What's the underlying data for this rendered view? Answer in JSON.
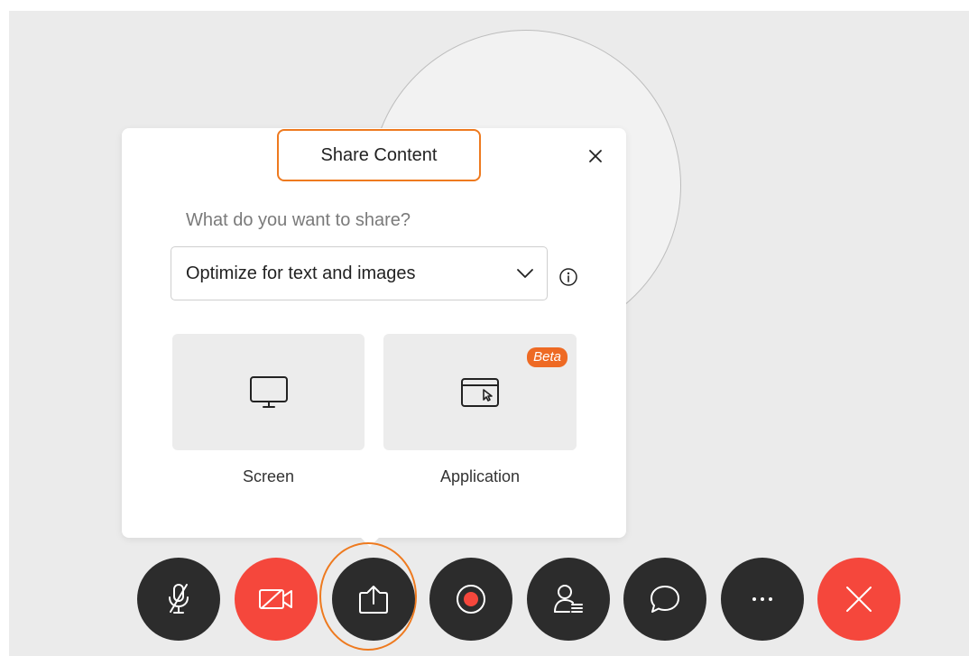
{
  "dialog": {
    "title": "Share Content",
    "question": "What do you want to share?",
    "optimize_select": {
      "value": "Optimize for text and images"
    },
    "options": [
      {
        "label": "Screen",
        "icon": "monitor-icon"
      },
      {
        "label": "Application",
        "icon": "application-window-icon",
        "badge": "Beta"
      }
    ]
  },
  "toolbar": {
    "buttons": [
      {
        "name": "mute-button",
        "icon": "microphone-off-icon"
      },
      {
        "name": "stop-video-button",
        "icon": "video-off-icon",
        "color": "#f5473c"
      },
      {
        "name": "share-button",
        "icon": "share-upload-icon"
      },
      {
        "name": "record-button",
        "icon": "record-icon"
      },
      {
        "name": "participants-button",
        "icon": "participants-icon"
      },
      {
        "name": "chat-button",
        "icon": "chat-bubble-icon"
      },
      {
        "name": "more-options-button",
        "icon": "more-icon"
      },
      {
        "name": "leave-meeting-button",
        "icon": "close-icon",
        "color": "#f5473c"
      }
    ]
  },
  "colors": {
    "accent_highlight": "#ee7a1f",
    "beta_badge": "#ee6a24",
    "danger": "#f5473c",
    "toolbar_button": "#2c2c2c"
  }
}
